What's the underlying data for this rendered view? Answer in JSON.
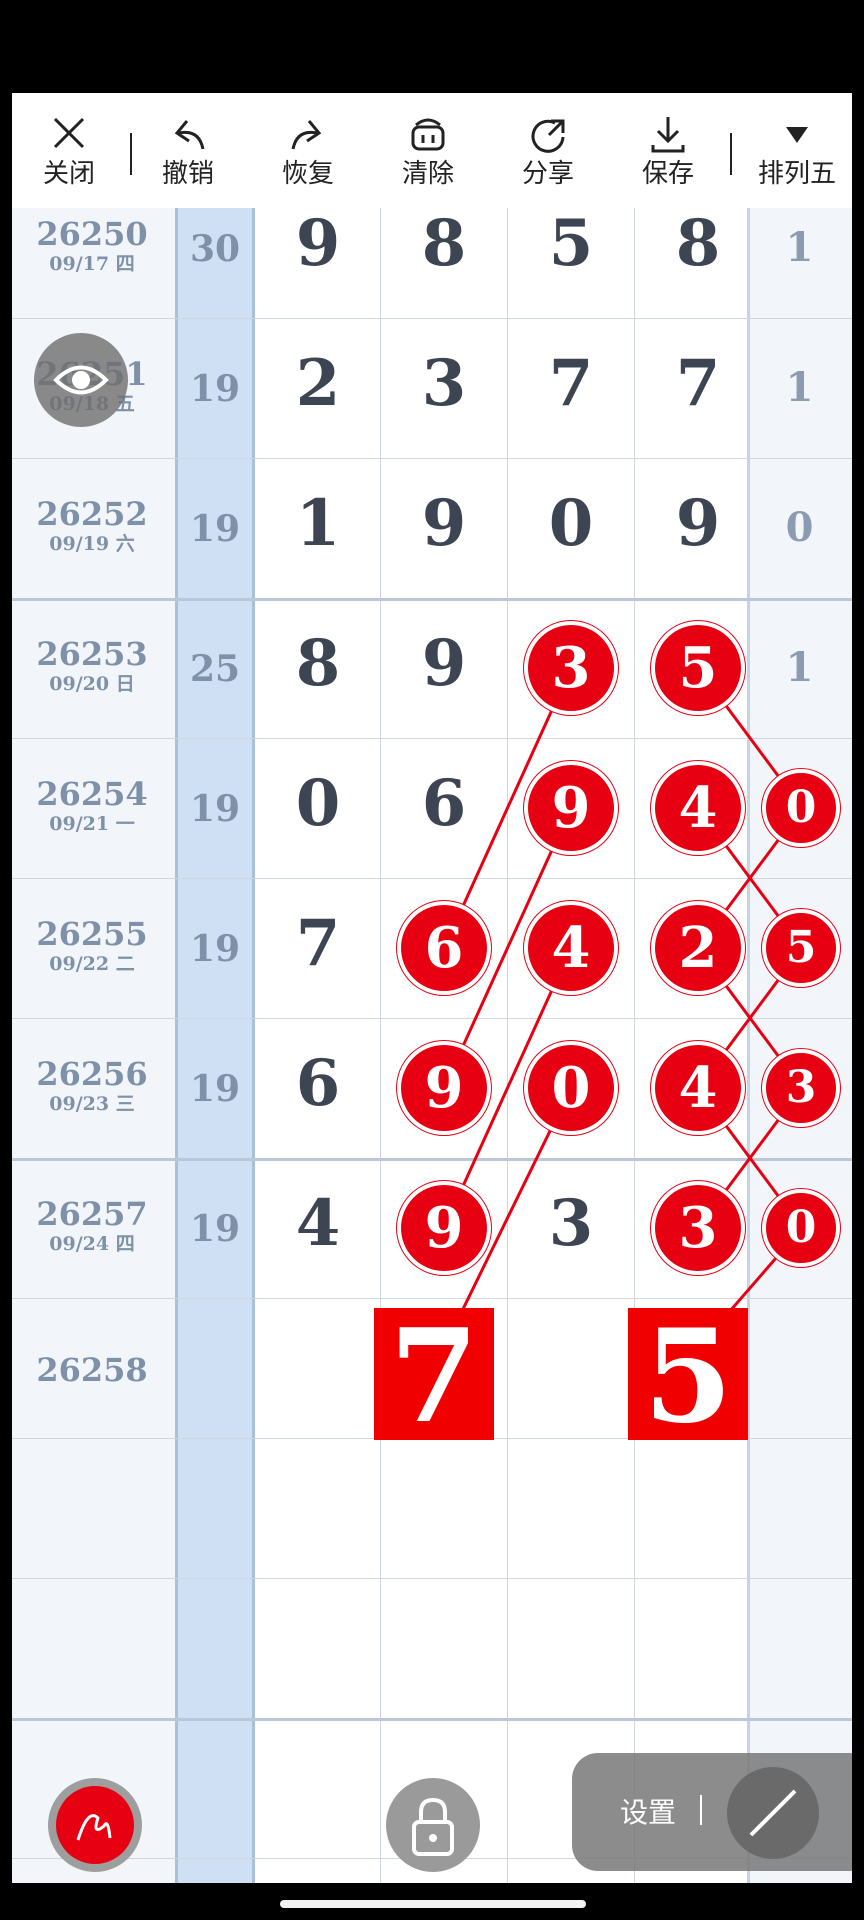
{
  "toolbar": {
    "items": [
      {
        "label": "关闭",
        "icon": "close-icon"
      },
      {
        "label": "撤销",
        "icon": "undo-icon"
      },
      {
        "label": "恢复",
        "icon": "redo-icon"
      },
      {
        "label": "清除",
        "icon": "clear-icon"
      },
      {
        "label": "分享",
        "icon": "share-icon"
      },
      {
        "label": "保存",
        "icon": "save-icon"
      },
      {
        "label": "排列五",
        "icon": "dropdown-triangle-icon"
      }
    ]
  },
  "rows": [
    {
      "issue": "26250",
      "date": "09/17 四",
      "sum": "30",
      "d": [
        "9",
        "8",
        "5",
        "8"
      ],
      "last": "1"
    },
    {
      "issue": "26251",
      "date": "09/18 五",
      "sum": "19",
      "d": [
        "2",
        "3",
        "7",
        "7"
      ],
      "last": "1"
    },
    {
      "issue": "26252",
      "date": "09/19 六",
      "sum": "19",
      "d": [
        "1",
        "9",
        "0",
        "9"
      ],
      "last": "0"
    },
    {
      "issue": "26253",
      "date": "09/20 日",
      "sum": "25",
      "d": [
        "8",
        "9",
        "3",
        "5"
      ],
      "last": "1"
    },
    {
      "issue": "26254",
      "date": "09/21 一",
      "sum": "19",
      "d": [
        "0",
        "6",
        "9",
        "4"
      ],
      "last": "0"
    },
    {
      "issue": "26255",
      "date": "09/22 二",
      "sum": "19",
      "d": [
        "7",
        "6",
        "4",
        "2"
      ],
      "last": "5"
    },
    {
      "issue": "26256",
      "date": "09/23 三",
      "sum": "19",
      "d": [
        "6",
        "9",
        "0",
        "4"
      ],
      "last": "3"
    },
    {
      "issue": "26257",
      "date": "09/24 四",
      "sum": "19",
      "d": [
        "4",
        "9",
        "3",
        "3"
      ],
      "last": "0"
    },
    {
      "issue": "26258",
      "date": "",
      "sum": "",
      "d": [
        "",
        "7",
        "",
        "5"
      ],
      "last": ""
    }
  ],
  "predictions": {
    "col2": "7",
    "col4": "5"
  },
  "settings": {
    "label": "设置"
  },
  "colors": {
    "accent": "#e60012",
    "sum_column": "#cfe0f5",
    "digit": "#3d4553"
  }
}
